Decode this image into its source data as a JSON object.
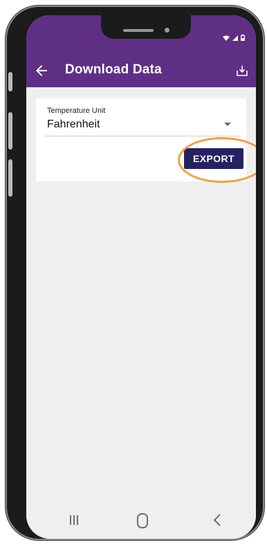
{
  "app_bar": {
    "title": "Download Data",
    "back_icon": "arrow-left-icon",
    "download_icon": "download-tray-icon",
    "color": "#5f2f86"
  },
  "settings_card": {
    "field_label": "Temperature Unit",
    "field_value": "Fahrenheit",
    "export_label": "EXPORT",
    "export_color": "#262262",
    "highlight_color": "#f0a23c"
  },
  "nav_bar": {
    "recents_icon": "recents-icon",
    "home_icon": "home-icon",
    "back_icon": "back-chevron-icon"
  }
}
